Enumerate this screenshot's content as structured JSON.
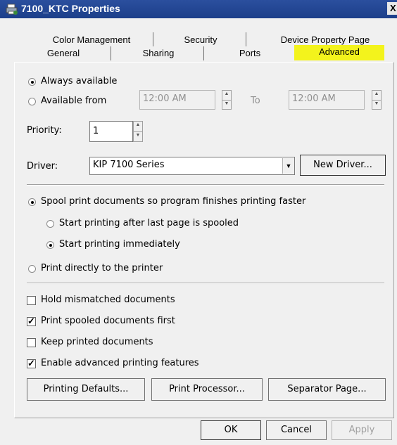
{
  "window": {
    "title": "7100_KTC Properties",
    "close_label": "X",
    "highlight_color": "#f3f31c"
  },
  "tabs": {
    "row1": [
      "Color Management",
      "Security",
      "Device Property Page"
    ],
    "row2": [
      "General",
      "Sharing",
      "Ports",
      "Advanced"
    ],
    "active": "Advanced"
  },
  "availability": {
    "always_label": "Always available",
    "from_label": "Available from",
    "from_time": "12:00 AM",
    "to_label": "To",
    "to_time": "12:00 AM",
    "selected": "always"
  },
  "priority": {
    "label": "Priority:",
    "value": "1"
  },
  "driver": {
    "label": "Driver:",
    "value": "KIP 7100 Series",
    "new_driver_label": "New Driver..."
  },
  "spooling": {
    "spool_label": "Spool print documents so program finishes printing faster",
    "after_last_label": "Start printing after last page is spooled",
    "immediately_label": "Start printing immediately",
    "direct_label": "Print directly to the printer",
    "selected_mode": "spool",
    "selected_start": "immediately"
  },
  "options": [
    {
      "label": "Hold mismatched documents",
      "checked": false
    },
    {
      "label": "Print spooled documents first",
      "checked": true
    },
    {
      "label": "Keep printed documents",
      "checked": false
    },
    {
      "label": "Enable advanced printing features",
      "checked": true
    }
  ],
  "buttons": {
    "printing_defaults": "Printing Defaults...",
    "print_processor": "Print Processor...",
    "separator_page": "Separator Page...",
    "ok": "OK",
    "cancel": "Cancel",
    "apply": "Apply"
  }
}
